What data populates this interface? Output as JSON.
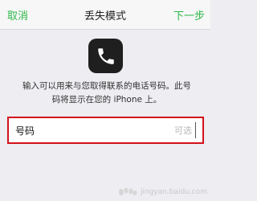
{
  "nav": {
    "cancel": "取消",
    "title": "丢失模式",
    "next": "下一步"
  },
  "icons": {
    "phone": "phone-icon"
  },
  "description": {
    "line1": "输入可以用来与您取得联系的电话号码。此号",
    "line2": "码将显示在您的 iPhone 上。"
  },
  "field": {
    "label": "号码",
    "placeholder": "可选"
  },
  "watermark": {
    "text": "jingyan.baidu.com"
  },
  "colors": {
    "accent": "#2fb84a",
    "highlight_border": "#d2121a"
  }
}
